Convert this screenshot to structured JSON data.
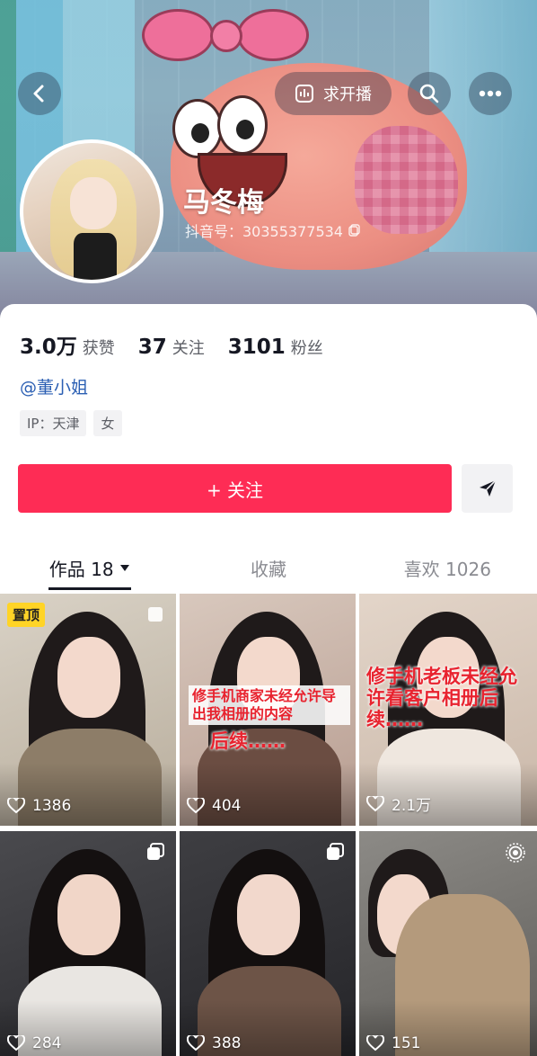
{
  "header": {
    "live_label": "求开播",
    "nickname": "马冬梅",
    "douyin_id": "抖音号：30355377534"
  },
  "stats": [
    {
      "num": "3.0万",
      "label": "获赞"
    },
    {
      "num": "37",
      "label": "关注"
    },
    {
      "num": "3101",
      "label": "粉丝"
    }
  ],
  "account_handle": "@董小姐",
  "tags": [
    "IP：天津",
    "女"
  ],
  "follow_label": "+ 关注",
  "tabs": [
    {
      "label": "作品 18"
    },
    {
      "label": "收藏"
    },
    {
      "label": "喜欢 1026"
    }
  ],
  "videos": [
    {
      "likes": "1386",
      "badge": "置顶",
      "caption": ""
    },
    {
      "likes": "404",
      "caption": "修手机商家未经允许导出我相册的内容",
      "caption2": "后续……"
    },
    {
      "likes": "2.1万",
      "caption": "修手机老板未经允许看客户相册后续……"
    },
    {
      "likes": "284"
    },
    {
      "likes": "388"
    },
    {
      "likes": "151"
    }
  ],
  "colors": {
    "follow_red": "#fe2c55",
    "account_blue": "#2b5fb3",
    "caption_red": "#e8232f",
    "pin_yellow": "#ffd426"
  },
  "icons": [
    "back-arrow-icon",
    "live-chart-icon",
    "search-icon",
    "more-icon",
    "copy-icon",
    "share-icon",
    "dropdown-triangle-icon",
    "heart-icon",
    "multi-image-icon",
    "live-photo-icon"
  ]
}
